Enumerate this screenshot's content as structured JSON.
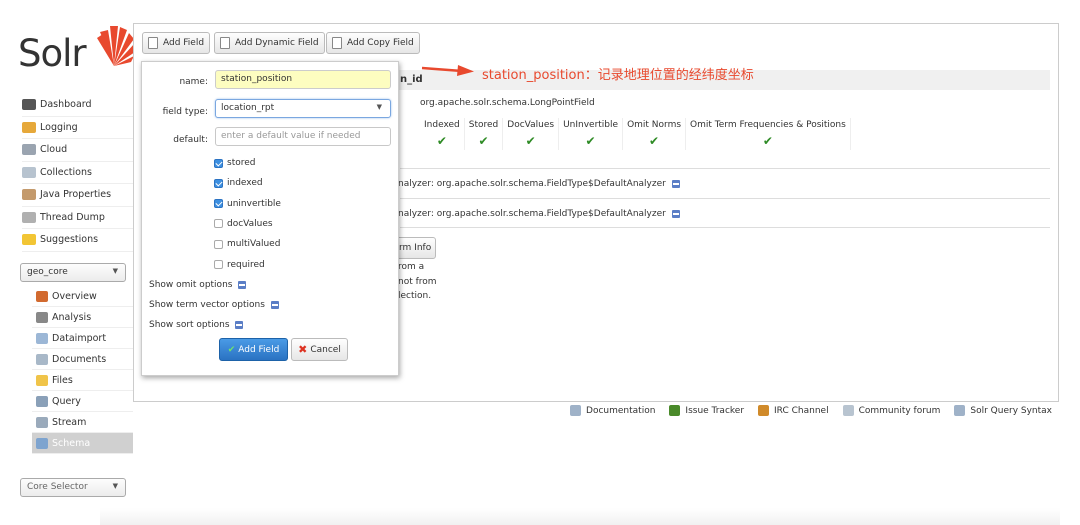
{
  "logo": {
    "text": "Solr"
  },
  "nav": {
    "items": [
      {
        "label": "Dashboard",
        "icon": "dashboard-icon",
        "color": "#555"
      },
      {
        "label": "Logging",
        "icon": "logging-icon",
        "color": "#e6a83a"
      },
      {
        "label": "Cloud",
        "icon": "cloud-icon",
        "color": "#9aa4b0"
      },
      {
        "label": "Collections",
        "icon": "collections-icon",
        "color": "#b7c3cf"
      },
      {
        "label": "Java Properties",
        "icon": "java-icon",
        "color": "#c49a6c"
      },
      {
        "label": "Thread Dump",
        "icon": "thread-dump-icon",
        "color": "#b0b0b0"
      },
      {
        "label": "Suggestions",
        "icon": "bulb-icon",
        "color": "#f2c534"
      }
    ]
  },
  "core_select": {
    "value": "geo_core"
  },
  "core_nav": {
    "items": [
      {
        "label": "Overview",
        "icon": "home-icon",
        "color": "#d26a2f"
      },
      {
        "label": "Analysis",
        "icon": "funnel-icon",
        "color": "#888"
      },
      {
        "label": "Dataimport",
        "icon": "import-icon",
        "color": "#9cb7d6"
      },
      {
        "label": "Documents",
        "icon": "documents-icon",
        "color": "#a8b8c8"
      },
      {
        "label": "Files",
        "icon": "folder-icon",
        "color": "#f0c449"
      },
      {
        "label": "Query",
        "icon": "magnifier-icon",
        "color": "#8aa0b8"
      },
      {
        "label": "Stream",
        "icon": "stream-icon",
        "color": "#9aaabb"
      },
      {
        "label": "Schema",
        "icon": "schema-icon",
        "color": "#7ea4cf"
      }
    ]
  },
  "core_selector": {
    "placeholder": "Core Selector"
  },
  "toolbar": {
    "add_field": "Add Field",
    "add_dynamic_field": "Add Dynamic Field",
    "add_copy_field": "Add Copy Field"
  },
  "annotation": {
    "text": "station_position：记录地理位置的经纬度坐标",
    "color": "#e8492e"
  },
  "background": {
    "field_title_fragment": "n_id",
    "class_name": "org.apache.solr.schema.LongPointField",
    "prop_headers": [
      "Indexed",
      "Stored",
      "DocValues",
      "UnInvertible",
      "Omit Norms",
      "Omit Term Frequencies & Positions"
    ],
    "index_analyzer": "nalyzer: org.apache.solr.schema.FieldType$DefaultAnalyzer",
    "query_analyzer": "nalyzer: org.apache.solr.schema.FieldType$DefaultAnalyzer",
    "term_info_label": "rm Info",
    "text_line1": "rom a",
    "text_line2": "not from",
    "text_line3": "lection."
  },
  "modal": {
    "name_label": "name:",
    "name_value": "station_position",
    "type_label": "field type:",
    "type_value": "location_rpt",
    "default_label": "default:",
    "default_placeholder": "enter a default value if needed",
    "checkboxes": [
      {
        "label": "stored",
        "checked": true
      },
      {
        "label": "indexed",
        "checked": true
      },
      {
        "label": "uninvertible",
        "checked": true
      },
      {
        "label": "docValues",
        "checked": false
      },
      {
        "label": "multiValued",
        "checked": false
      },
      {
        "label": "required",
        "checked": false
      }
    ],
    "show_omit": "Show omit options",
    "show_term_vector": "Show term vector options",
    "show_sort": "Show sort options",
    "add_button": "Add Field",
    "cancel_button": "Cancel"
  },
  "footer": {
    "links": [
      {
        "label": "Documentation",
        "icon": "document-icon",
        "color": "#9fb2c8"
      },
      {
        "label": "Issue Tracker",
        "icon": "bug-icon",
        "color": "#4a8a2a"
      },
      {
        "label": "IRC Channel",
        "icon": "people-icon",
        "color": "#d08a2a"
      },
      {
        "label": "Community forum",
        "icon": "mail-icon",
        "color": "#b8c4d0"
      },
      {
        "label": "Solr Query Syntax",
        "icon": "syntax-icon",
        "color": "#9fb2c8"
      }
    ]
  }
}
